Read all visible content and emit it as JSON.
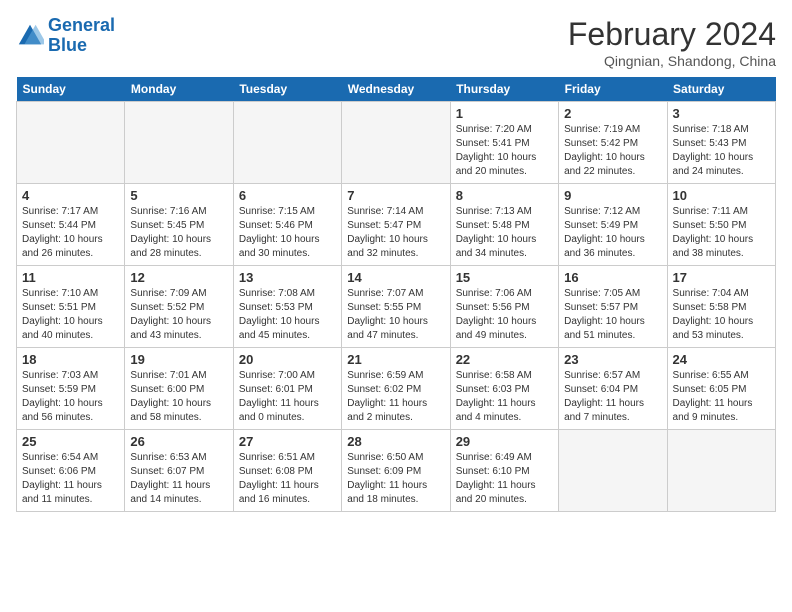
{
  "header": {
    "logo_line1": "General",
    "logo_line2": "Blue",
    "month_title": "February 2024",
    "location": "Qingnian, Shandong, China"
  },
  "days_of_week": [
    "Sunday",
    "Monday",
    "Tuesday",
    "Wednesday",
    "Thursday",
    "Friday",
    "Saturday"
  ],
  "weeks": [
    [
      {
        "day": "",
        "empty": true
      },
      {
        "day": "",
        "empty": true
      },
      {
        "day": "",
        "empty": true
      },
      {
        "day": "",
        "empty": true
      },
      {
        "day": "1",
        "info": "Sunrise: 7:20 AM\nSunset: 5:41 PM\nDaylight: 10 hours\nand 20 minutes."
      },
      {
        "day": "2",
        "info": "Sunrise: 7:19 AM\nSunset: 5:42 PM\nDaylight: 10 hours\nand 22 minutes."
      },
      {
        "day": "3",
        "info": "Sunrise: 7:18 AM\nSunset: 5:43 PM\nDaylight: 10 hours\nand 24 minutes."
      }
    ],
    [
      {
        "day": "4",
        "info": "Sunrise: 7:17 AM\nSunset: 5:44 PM\nDaylight: 10 hours\nand 26 minutes."
      },
      {
        "day": "5",
        "info": "Sunrise: 7:16 AM\nSunset: 5:45 PM\nDaylight: 10 hours\nand 28 minutes."
      },
      {
        "day": "6",
        "info": "Sunrise: 7:15 AM\nSunset: 5:46 PM\nDaylight: 10 hours\nand 30 minutes."
      },
      {
        "day": "7",
        "info": "Sunrise: 7:14 AM\nSunset: 5:47 PM\nDaylight: 10 hours\nand 32 minutes."
      },
      {
        "day": "8",
        "info": "Sunrise: 7:13 AM\nSunset: 5:48 PM\nDaylight: 10 hours\nand 34 minutes."
      },
      {
        "day": "9",
        "info": "Sunrise: 7:12 AM\nSunset: 5:49 PM\nDaylight: 10 hours\nand 36 minutes."
      },
      {
        "day": "10",
        "info": "Sunrise: 7:11 AM\nSunset: 5:50 PM\nDaylight: 10 hours\nand 38 minutes."
      }
    ],
    [
      {
        "day": "11",
        "info": "Sunrise: 7:10 AM\nSunset: 5:51 PM\nDaylight: 10 hours\nand 40 minutes."
      },
      {
        "day": "12",
        "info": "Sunrise: 7:09 AM\nSunset: 5:52 PM\nDaylight: 10 hours\nand 43 minutes."
      },
      {
        "day": "13",
        "info": "Sunrise: 7:08 AM\nSunset: 5:53 PM\nDaylight: 10 hours\nand 45 minutes."
      },
      {
        "day": "14",
        "info": "Sunrise: 7:07 AM\nSunset: 5:55 PM\nDaylight: 10 hours\nand 47 minutes."
      },
      {
        "day": "15",
        "info": "Sunrise: 7:06 AM\nSunset: 5:56 PM\nDaylight: 10 hours\nand 49 minutes."
      },
      {
        "day": "16",
        "info": "Sunrise: 7:05 AM\nSunset: 5:57 PM\nDaylight: 10 hours\nand 51 minutes."
      },
      {
        "day": "17",
        "info": "Sunrise: 7:04 AM\nSunset: 5:58 PM\nDaylight: 10 hours\nand 53 minutes."
      }
    ],
    [
      {
        "day": "18",
        "info": "Sunrise: 7:03 AM\nSunset: 5:59 PM\nDaylight: 10 hours\nand 56 minutes."
      },
      {
        "day": "19",
        "info": "Sunrise: 7:01 AM\nSunset: 6:00 PM\nDaylight: 10 hours\nand 58 minutes."
      },
      {
        "day": "20",
        "info": "Sunrise: 7:00 AM\nSunset: 6:01 PM\nDaylight: 11 hours\nand 0 minutes."
      },
      {
        "day": "21",
        "info": "Sunrise: 6:59 AM\nSunset: 6:02 PM\nDaylight: 11 hours\nand 2 minutes."
      },
      {
        "day": "22",
        "info": "Sunrise: 6:58 AM\nSunset: 6:03 PM\nDaylight: 11 hours\nand 4 minutes."
      },
      {
        "day": "23",
        "info": "Sunrise: 6:57 AM\nSunset: 6:04 PM\nDaylight: 11 hours\nand 7 minutes."
      },
      {
        "day": "24",
        "info": "Sunrise: 6:55 AM\nSunset: 6:05 PM\nDaylight: 11 hours\nand 9 minutes."
      }
    ],
    [
      {
        "day": "25",
        "info": "Sunrise: 6:54 AM\nSunset: 6:06 PM\nDaylight: 11 hours\nand 11 minutes."
      },
      {
        "day": "26",
        "info": "Sunrise: 6:53 AM\nSunset: 6:07 PM\nDaylight: 11 hours\nand 14 minutes."
      },
      {
        "day": "27",
        "info": "Sunrise: 6:51 AM\nSunset: 6:08 PM\nDaylight: 11 hours\nand 16 minutes."
      },
      {
        "day": "28",
        "info": "Sunrise: 6:50 AM\nSunset: 6:09 PM\nDaylight: 11 hours\nand 18 minutes."
      },
      {
        "day": "29",
        "info": "Sunrise: 6:49 AM\nSunset: 6:10 PM\nDaylight: 11 hours\nand 20 minutes."
      },
      {
        "day": "",
        "empty": true
      },
      {
        "day": "",
        "empty": true
      }
    ]
  ]
}
